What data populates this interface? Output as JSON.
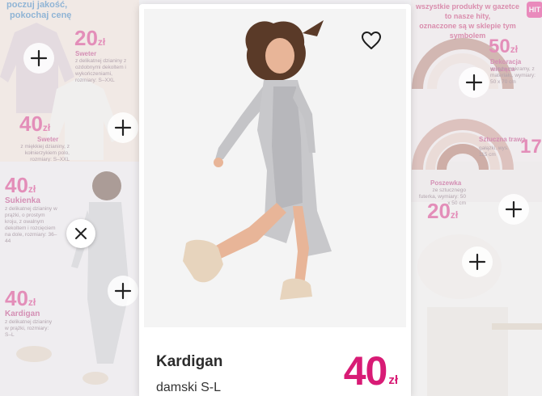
{
  "colors": {
    "accent": "#d81b75",
    "slogan": "#1e6fb3"
  },
  "leaflet": {
    "slogan_line1": "poczuj jakość,",
    "slogan_line2": "pokochaj cenę",
    "right_note_line1": "wszystkie produkty w gazetce to nasze hity,",
    "right_note_line2": "oznaczone są w sklepie tym symbolem",
    "hit_badge": "HIT",
    "currency": "zł",
    "items": [
      {
        "price": "20",
        "title": "Sweter",
        "desc": "z delikatnej dzianiny z ozdobnymi dekoltem i wykończeniami, rozmiary: S–XXL"
      },
      {
        "price": "40",
        "title": "Sweter",
        "desc": "z miękkiej dzianiny, z kołnierzykiem polo, rozmiary: S–XXL"
      },
      {
        "price": "40",
        "title": "Sukienka",
        "desc": "z delikatnej dzianiny w prążki, o prostym kroju, z owalnym dekoltem i rozcięciem na dole, rozmiary: 36–44"
      },
      {
        "price": "40",
        "title": "Kardigan",
        "desc": "z delikatnej dzianiny w prążki, rozmiary: S–L"
      },
      {
        "price": "50",
        "title": "Dekoracja wisząca",
        "desc": "w stylu makramy, z materiału, wymiary: 50 x 70 cm"
      },
      {
        "price": "",
        "title": "Sztuczna trawa",
        "desc": "gałązki, wys. 115 cm"
      },
      {
        "price": "17",
        "title": "",
        "desc": ""
      },
      {
        "price": "20",
        "title": "Poszewka",
        "desc": "ze sztucznego futerka, wymiary: 50 x 50 cm"
      }
    ]
  },
  "card": {
    "title": "Kardigan",
    "subtitle": "damski S-L",
    "price": "40",
    "currency": "zł"
  },
  "icons": {
    "close": "close-icon",
    "favorite": "heart-icon",
    "add": "plus-icon"
  }
}
